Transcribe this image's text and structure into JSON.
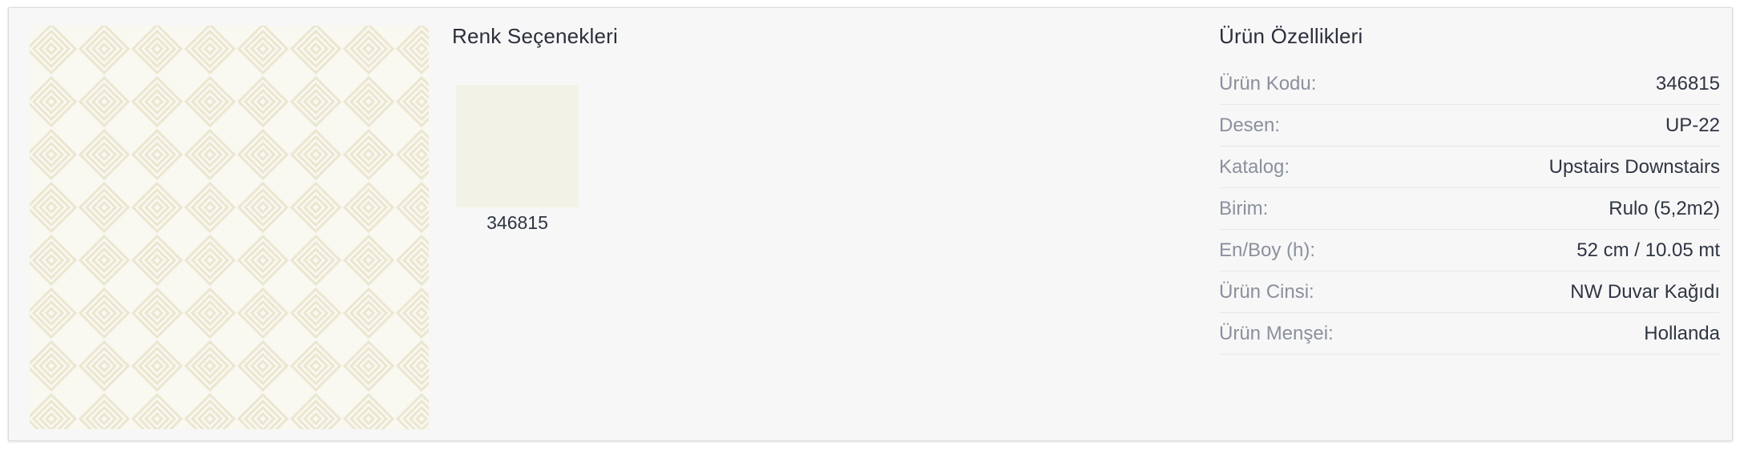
{
  "colors": {
    "title": "Renk Seçenekleri",
    "options": [
      {
        "code": "346815",
        "color": "#f3f2e6"
      }
    ]
  },
  "specs": {
    "title": "Ürün Özellikleri",
    "rows": [
      {
        "label": "Ürün Kodu:",
        "value": "346815"
      },
      {
        "label": "Desen:",
        "value": "UP-22"
      },
      {
        "label": "Katalog:",
        "value": "Upstairs Downstairs"
      },
      {
        "label": "Birim:",
        "value": "Rulo (5,2m2)"
      },
      {
        "label": "En/Boy (h):",
        "value": "52 cm / 10.05 mt"
      },
      {
        "label": "Ürün Cinsi:",
        "value": "NW Duvar Kağıdı"
      },
      {
        "label": "Ürün Menşei:",
        "value": "Hollanda"
      }
    ]
  },
  "theme": {
    "pattern_bg": "#f9f8f1",
    "pattern_line": "#ebe6cf"
  }
}
